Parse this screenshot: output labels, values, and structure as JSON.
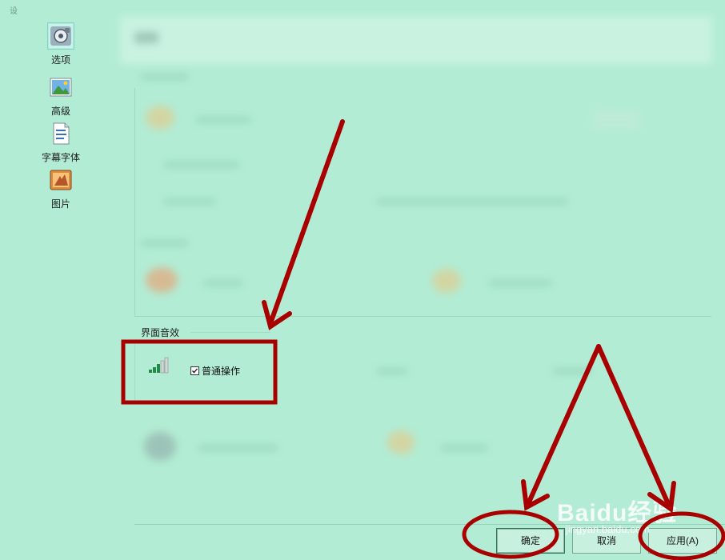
{
  "window": {
    "title_glyph": "设"
  },
  "sidebar": {
    "items": [
      {
        "label": "选项",
        "icon": "options-icon",
        "selected": true
      },
      {
        "label": "高级",
        "icon": "advanced-icon",
        "selected": false
      },
      {
        "label": "字幕字体",
        "icon": "subtitle-font-icon",
        "selected": false
      },
      {
        "label": "图片",
        "icon": "image-icon",
        "selected": false
      }
    ]
  },
  "sound_group": {
    "title": "界面音效",
    "normal_operation": {
      "label": "普通操作",
      "checked": true
    }
  },
  "buttons": {
    "ok": "确定",
    "cancel": "取消",
    "apply": "应用(A)"
  },
  "watermark": {
    "brand": "Baidu经验",
    "url": "jingyan.baidu.com"
  },
  "colors": {
    "background": "#b2ecd4",
    "annotation": "#a80000"
  }
}
